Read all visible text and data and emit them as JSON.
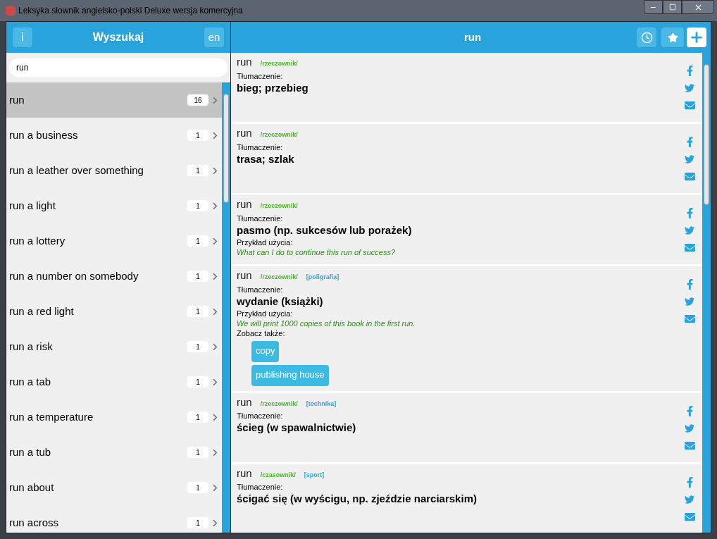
{
  "window": {
    "title": "Leksyka słownik angielsko-polski Deluxe wersja komercyjna"
  },
  "search_panel": {
    "info_button": "i",
    "title": "Wyszukaj",
    "language_button": "en",
    "search": {
      "value": "run"
    },
    "results": [
      {
        "label": "run",
        "count": "16",
        "selected": true
      },
      {
        "label": "run a business",
        "count": "1",
        "selected": false
      },
      {
        "label": "run a leather over something",
        "count": "1",
        "selected": false
      },
      {
        "label": "run a light",
        "count": "1",
        "selected": false
      },
      {
        "label": "run a lottery",
        "count": "1",
        "selected": false
      },
      {
        "label": "run a number on somebody",
        "count": "1",
        "selected": false
      },
      {
        "label": "run a red light",
        "count": "1",
        "selected": false
      },
      {
        "label": "run a risk",
        "count": "1",
        "selected": false
      },
      {
        "label": "run a tab",
        "count": "1",
        "selected": false
      },
      {
        "label": "run a temperature",
        "count": "1",
        "selected": false
      },
      {
        "label": "run a tub",
        "count": "1",
        "selected": false
      },
      {
        "label": "run about",
        "count": "1",
        "selected": false
      },
      {
        "label": "run across",
        "count": "1",
        "selected": false
      }
    ]
  },
  "entry_panel": {
    "title": "run",
    "entries": [
      {
        "word": "run",
        "part_of_speech": "/rzeczownik/",
        "translation_label": "Tłumaczenie:",
        "translation": "bieg; przebieg"
      },
      {
        "word": "run",
        "part_of_speech": "/rzeczownik/",
        "translation_label": "Tłumaczenie:",
        "translation": "trasa; szlak"
      },
      {
        "word": "run",
        "part_of_speech": "/rzeczownik/",
        "translation_label": "Tłumaczenie:",
        "translation": "pasmo (np. sukcesów lub porażek)",
        "example_label": "Przykład użycia:",
        "example": "What can I do to continue this run of success?"
      },
      {
        "word": "run",
        "part_of_speech": "/rzeczownik/",
        "domain": "[poligrafia]",
        "translation_label": "Tłumaczenie:",
        "translation": "wydanie (książki)",
        "example_label": "Przykład użycia:",
        "example": "We will print 1000 copies of this book in the first run.",
        "see_also_label": "Zobacz także:",
        "see_also": [
          "copy",
          "publishing house"
        ]
      },
      {
        "word": "run",
        "part_of_speech": "/rzeczownik/",
        "domain": "[technika]",
        "translation_label": "Tłumaczenie:",
        "translation": "ścieg (w spawalnictwie)"
      },
      {
        "word": "run",
        "part_of_speech": "/czasownik/",
        "domain": "[sport]",
        "translation_label": "Tłumaczenie:",
        "translation": "ścigać się (w wyścigu, np. zjeździe narciarskim)"
      }
    ]
  }
}
